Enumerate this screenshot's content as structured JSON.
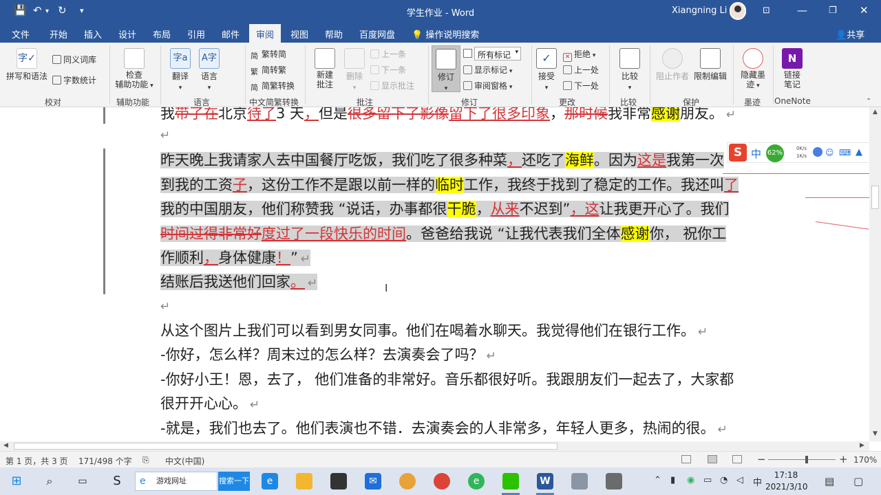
{
  "window": {
    "title": "学生作业 - Word",
    "user": "Xiangning Li",
    "quick_access": [
      "save-icon",
      "undo-icon",
      "redo-icon",
      "customize-icon"
    ],
    "controls": [
      "ribbon-display-icon",
      "minimize-icon",
      "restore-icon",
      "close-icon"
    ]
  },
  "tabs": [
    "文件",
    "开始",
    "插入",
    "设计",
    "布局",
    "引用",
    "邮件",
    "审阅",
    "视图",
    "帮助",
    "百度网盘"
  ],
  "active_tab": "审阅",
  "tell_me": "操作说明搜索",
  "share": "共享",
  "ribbon": {
    "proofing": {
      "spelling": "拼写和语法",
      "thesaurus": "同义词库",
      "word_count": "字数统计",
      "label": "校对"
    },
    "accessibility": {
      "check_line1": "检查",
      "check_line2": "辅助功能",
      "label": "辅助功能"
    },
    "language": {
      "translate": "翻译",
      "language": "语言",
      "label": "语言"
    },
    "chinese_conversion": {
      "to_simplified": "繁转简",
      "to_traditional": "简转繁",
      "convert": "简繁转换",
      "label": "中文简繁转换"
    },
    "comments": {
      "new_line1": "新建",
      "new_line2": "批注",
      "delete": "删除",
      "previous": "上一条",
      "next": "下一条",
      "show": "显示批注",
      "label": "批注"
    },
    "tracking": {
      "track": "修订",
      "markup_select": "所有标记",
      "show_markup": "显示标记",
      "review_pane": "审阅窗格",
      "label": "修订"
    },
    "changes": {
      "accept": "接受",
      "reject": "拒绝",
      "previous": "上一处",
      "next": "下一处",
      "label": "更改"
    },
    "compare": {
      "compare": "比较",
      "label": "比较"
    },
    "protect": {
      "block_authors": "阻止作者",
      "restrict_editing": "限制编辑",
      "label": "保护"
    },
    "ink": {
      "hide_ink_line1": "隐藏墨",
      "hide_ink_line2": "迹",
      "label": "墨迹"
    },
    "onenote": {
      "linked_line1": "链接",
      "linked_line2": "笔记",
      "label": "OneNote"
    }
  },
  "doc": {
    "p0": [
      {
        "t": "我",
        "s": "n"
      },
      {
        "t": "带了在",
        "s": "del"
      },
      {
        "t": "北京",
        "s": "n"
      },
      {
        "t": "待了",
        "s": "ins"
      },
      {
        "t": "3 天",
        "s": "n"
      },
      {
        "t": "，",
        "s": "ins"
      },
      {
        "t": "但是",
        "s": "n"
      },
      {
        "t": "很多留下了影像",
        "s": "del"
      },
      {
        "t": "留下了很多印象",
        "s": "ins"
      },
      {
        "t": "，",
        "s": "n"
      },
      {
        "t": "那时候",
        "s": "del"
      },
      {
        "t": "我非常",
        "s": "n"
      },
      {
        "t": "感谢",
        "s": "hl"
      },
      {
        "t": "朋友。",
        "s": "n"
      }
    ],
    "p2": [
      {
        "t": "昨天晚上我请家人去中国餐厅吃饭，我们吃了很多种菜",
        "s": "n"
      },
      {
        "t": "，",
        "s": "ins"
      },
      {
        "t": "还吃了",
        "s": "n"
      },
      {
        "t": "海鲜",
        "s": "hl"
      },
      {
        "t": "。因为",
        "s": "n"
      },
      {
        "t": "这是",
        "s": "ins"
      },
      {
        "t": "我第一次",
        "s": "n"
      }
    ],
    "p3": [
      {
        "t": "到我的工资",
        "s": "n"
      },
      {
        "t": "子",
        "s": "ins"
      },
      {
        "t": "，这份工作不是跟以前一样的",
        "s": "n"
      },
      {
        "t": "临时",
        "s": "hl"
      },
      {
        "t": "工作，我终于找到了稳定的工作。我还叫",
        "s": "n"
      },
      {
        "t": "了",
        "s": "ins"
      }
    ],
    "p4": [
      {
        "t": "我的中国朋友，他们称赞我 “说话，办事都很",
        "s": "n"
      },
      {
        "t": "干脆",
        "s": "hl"
      },
      {
        "t": "，",
        "s": "n"
      },
      {
        "t": "从来",
        "s": "ins"
      },
      {
        "t": "不迟到”",
        "s": "n"
      },
      {
        "t": "，这",
        "s": "ins"
      },
      {
        "t": "让我更开心了。我们",
        "s": "n"
      }
    ],
    "p5": [
      {
        "t": "时间过得非常好",
        "s": "del"
      },
      {
        "t": "度过了一段快乐的时间",
        "s": "ins"
      },
      {
        "t": "。爸爸给我说 “让我代表我们全体",
        "s": "n"
      },
      {
        "t": "感谢",
        "s": "hl"
      },
      {
        "t": "你，  祝你工",
        "s": "n"
      }
    ],
    "p6": [
      {
        "t": "作顺利",
        "s": "n"
      },
      {
        "t": "，",
        "s": "ins"
      },
      {
        "t": "身体健康",
        "s": "n"
      },
      {
        "t": "！",
        "s": "ins"
      },
      {
        "t": "”",
        "s": "n"
      }
    ],
    "p7": [
      {
        "t": "结账后我送他们回家",
        "s": "n"
      },
      {
        "t": "。",
        "s": "ins"
      }
    ],
    "p9": "从这个图片上我们可以看到男女同事。他们在喝着水聊天。我觉得他们在银行工作。",
    "p10": "-你好，怎么样？周末过的怎么样？去演奏会了吗？",
    "p11": "-你好小王！恩，去了，  他们准备的非常好。音乐都很好听。我跟朋友们一起去了，大家都",
    "p12": "很开开心心。",
    "p13": "-就是，我们也去了。他们表演也不错．去演奏会的人非常多，年轻人更多，热闹的很。",
    "pilcrow": "↵"
  },
  "ime": {
    "logo": "S",
    "mode": "中",
    "percent": "62%",
    "up": "0K/s",
    "down": "1K/s"
  },
  "status": {
    "page": "第 1 页，共 3 页",
    "words": "171/498 个字",
    "language": "中文(中国)",
    "zoom": "170%",
    "zoom_minus": "−",
    "zoom_plus": "+"
  },
  "taskbar": {
    "search_text": "游戏网址",
    "search_button": "搜索一下",
    "time": "17:18",
    "date": "2021/3/10",
    "ime_mode": "中"
  },
  "colors": {
    "brand": "#2b579a",
    "revision": "#d13438",
    "highlight": "#ffff00",
    "selection": "#d4d4d4"
  }
}
